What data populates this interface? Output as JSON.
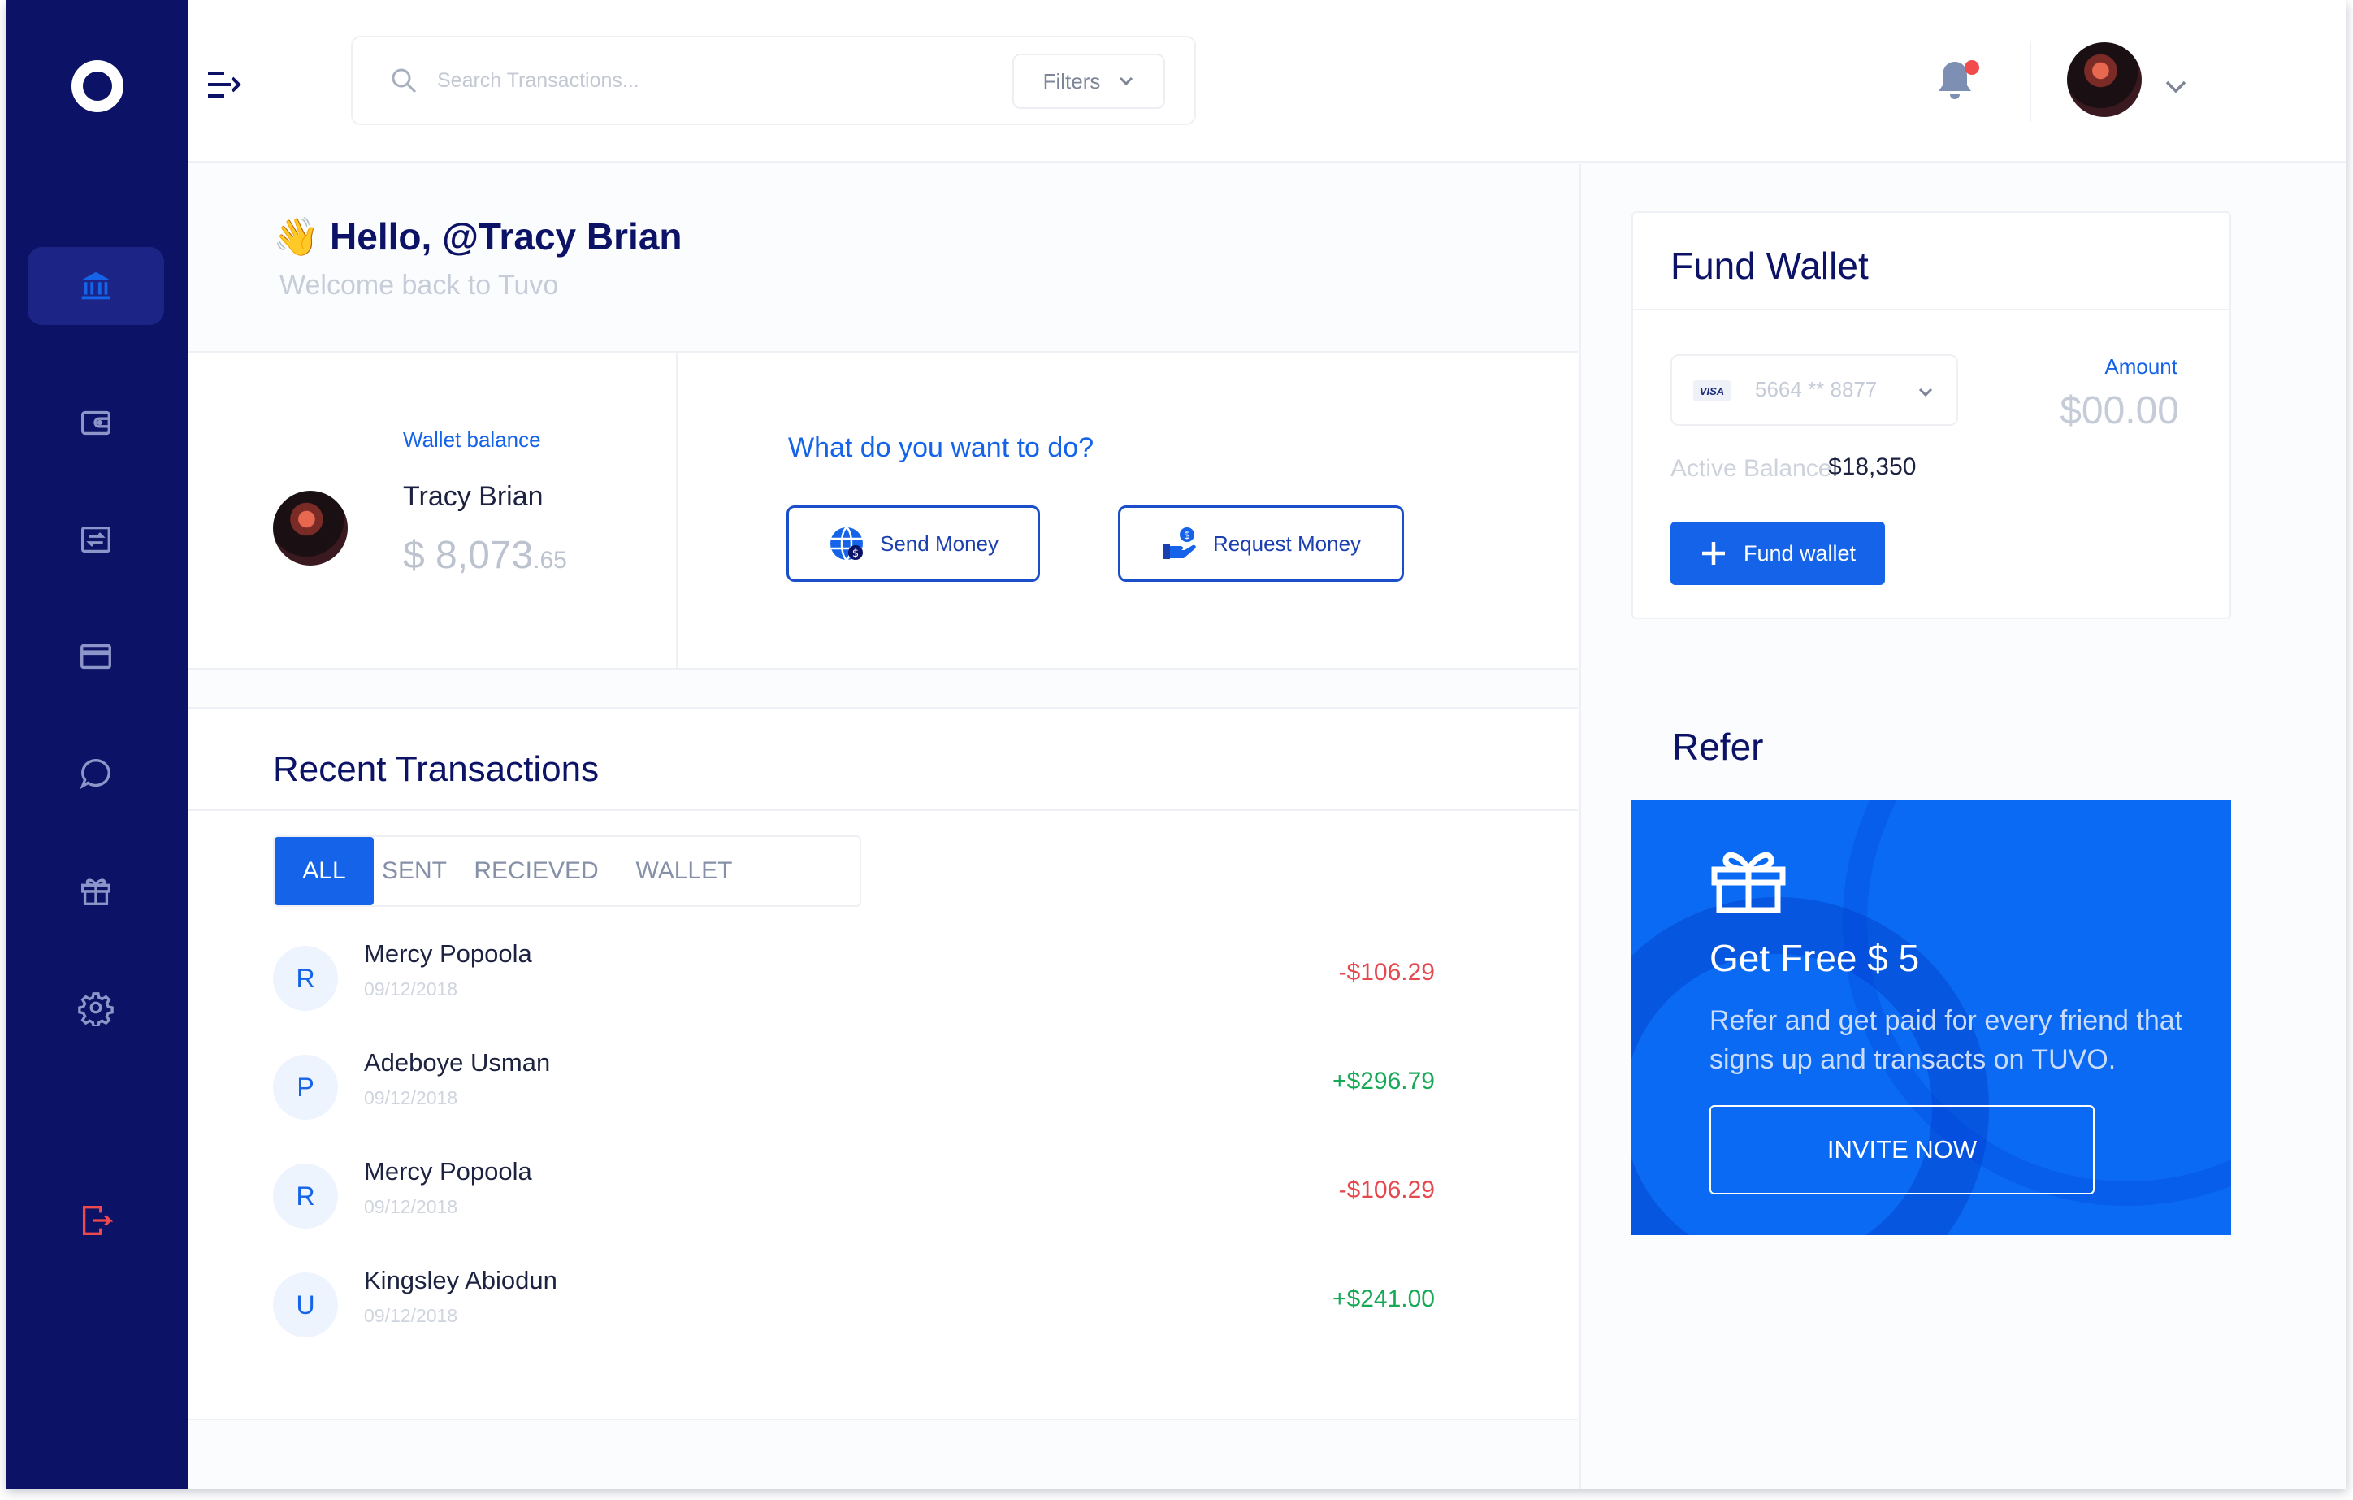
{
  "header": {
    "search_placeholder": "Search Transactions...",
    "filters_label": "Filters"
  },
  "greeting": {
    "hello": "👋 Hello, @Tracy Brian",
    "welcome": "Welcome back to Tuvo"
  },
  "wallet": {
    "label": "Wallet balance",
    "name": "Tracy Brian",
    "balance_main": "$ 8,073",
    "balance_cents": ".65"
  },
  "actions": {
    "heading": "What do you want to do?",
    "send_label": "Send Money",
    "request_label": "Request Money"
  },
  "transactions": {
    "title": "Recent Transactions",
    "tabs": [
      "ALL",
      "SENT",
      "RECIEVED",
      "WALLET"
    ],
    "items": [
      {
        "initial": "R",
        "name": "Mercy Popoola",
        "date": "09/12/2018",
        "amount": "-$106.29",
        "type": "debit"
      },
      {
        "initial": "P",
        "name": "Adeboye Usman",
        "date": "09/12/2018",
        "amount": "+$296.79",
        "type": "credit"
      },
      {
        "initial": "R",
        "name": "Mercy Popoola",
        "date": "09/12/2018",
        "amount": "-$106.29",
        "type": "debit"
      },
      {
        "initial": "U",
        "name": "Kingsley Abiodun",
        "date": "09/12/2018",
        "amount": "+$241.00",
        "type": "credit"
      }
    ]
  },
  "fund_wallet": {
    "title": "Fund Wallet",
    "card_brand": "VISA",
    "card_number": "5664 ** 8877",
    "amount_label": "Amount",
    "amount_value": "$00.00",
    "active_label": "Active Balance",
    "active_value": "$18,350",
    "button_label": "Fund wallet"
  },
  "refer": {
    "title": "Refer",
    "heading": "Get Free $ 5",
    "text": "Refer and get paid for every friend that signs up and transacts on TUVO.",
    "button_label": "INVITE NOW"
  },
  "colors": {
    "sidebar": "#0c1366",
    "accent": "#1463e8",
    "debit": "#e5484d",
    "credit": "#18a957",
    "logout": "#f0494b"
  },
  "icons": {
    "sidebar": [
      "bank-icon",
      "wallet-icon",
      "transfer-icon",
      "card-icon",
      "chat-icon",
      "gift-icon",
      "settings-icon",
      "logout-icon"
    ]
  }
}
